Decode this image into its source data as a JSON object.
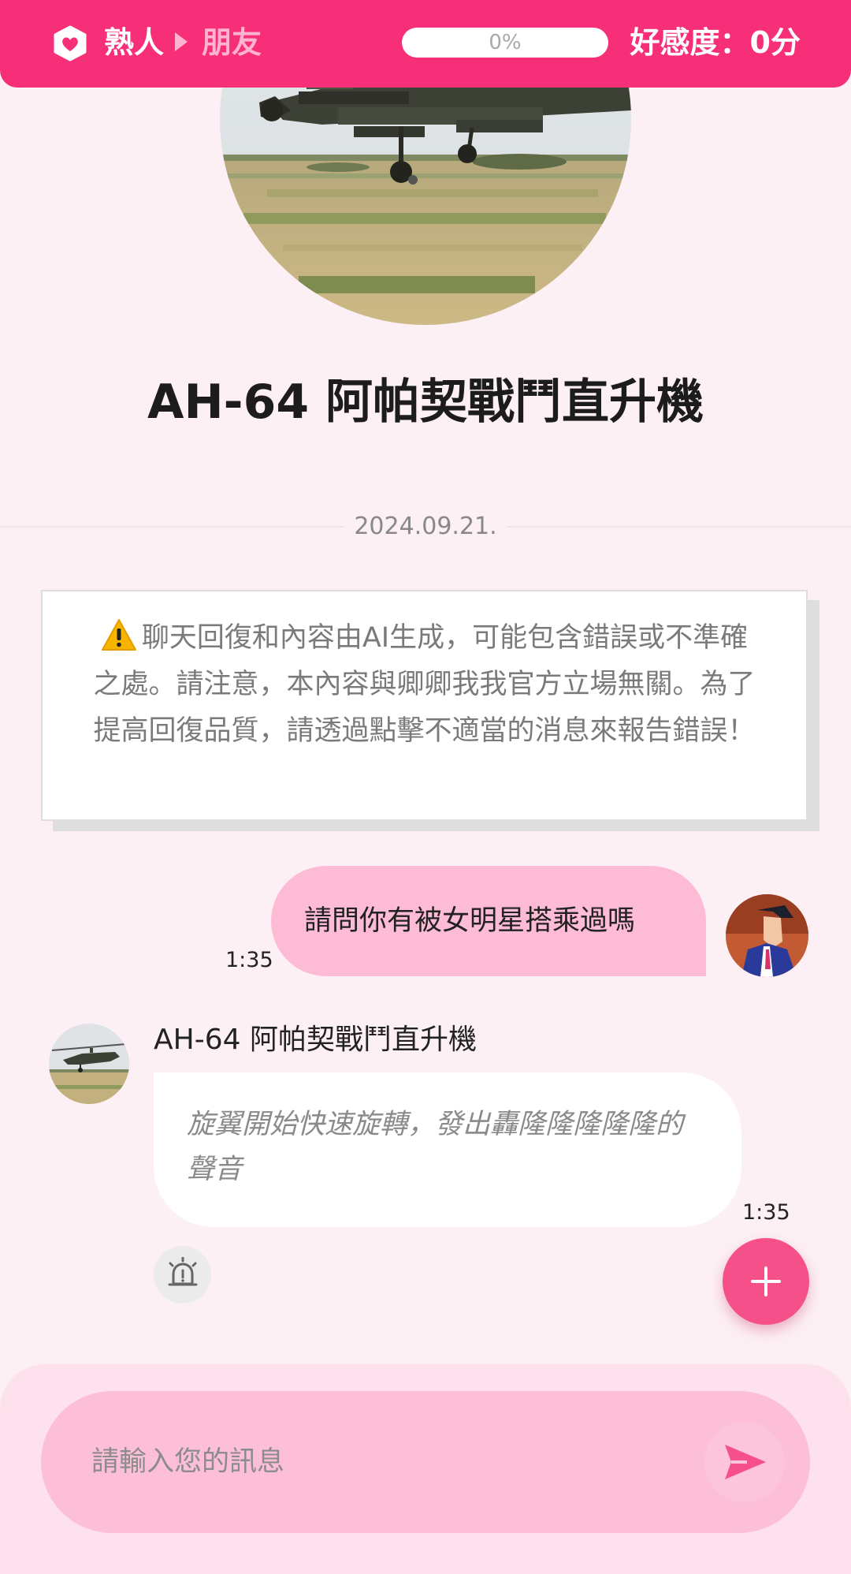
{
  "header": {
    "relationship_current": "熟人",
    "relationship_next": "朋友",
    "progress": 0,
    "progress_text": "0%",
    "affection_text": "好感度：0分",
    "accent_color": "#f62f78"
  },
  "character": {
    "name": "AH-64 阿帕契戰鬥直升機"
  },
  "conversation": {
    "date": "2024.09.21.",
    "disclaimer": "聊天回復和內容由AI生成，可能包含錯誤或不準確之處。請注意，本內容與卿卿我我官方立場無關。為了提高回復品質，請透過點擊不適當的消息來報告錯誤！",
    "messages": [
      {
        "sender": "user",
        "text": "請問你有被女明星搭乘過嗎",
        "time": "1:35"
      },
      {
        "sender": "bot",
        "name": "AH-64 阿帕契戰鬥直升機",
        "text": "旋翼開始快速旋轉，發出轟隆隆隆隆隆的聲音",
        "time": "1:35"
      }
    ]
  },
  "input": {
    "placeholder": "請輸入您的訊息"
  },
  "icons": {
    "relationship": "heart-shield-icon",
    "warning": "warning-icon",
    "report": "alarm-siren-icon",
    "add": "plus-icon",
    "send": "send-arrow-icon"
  }
}
